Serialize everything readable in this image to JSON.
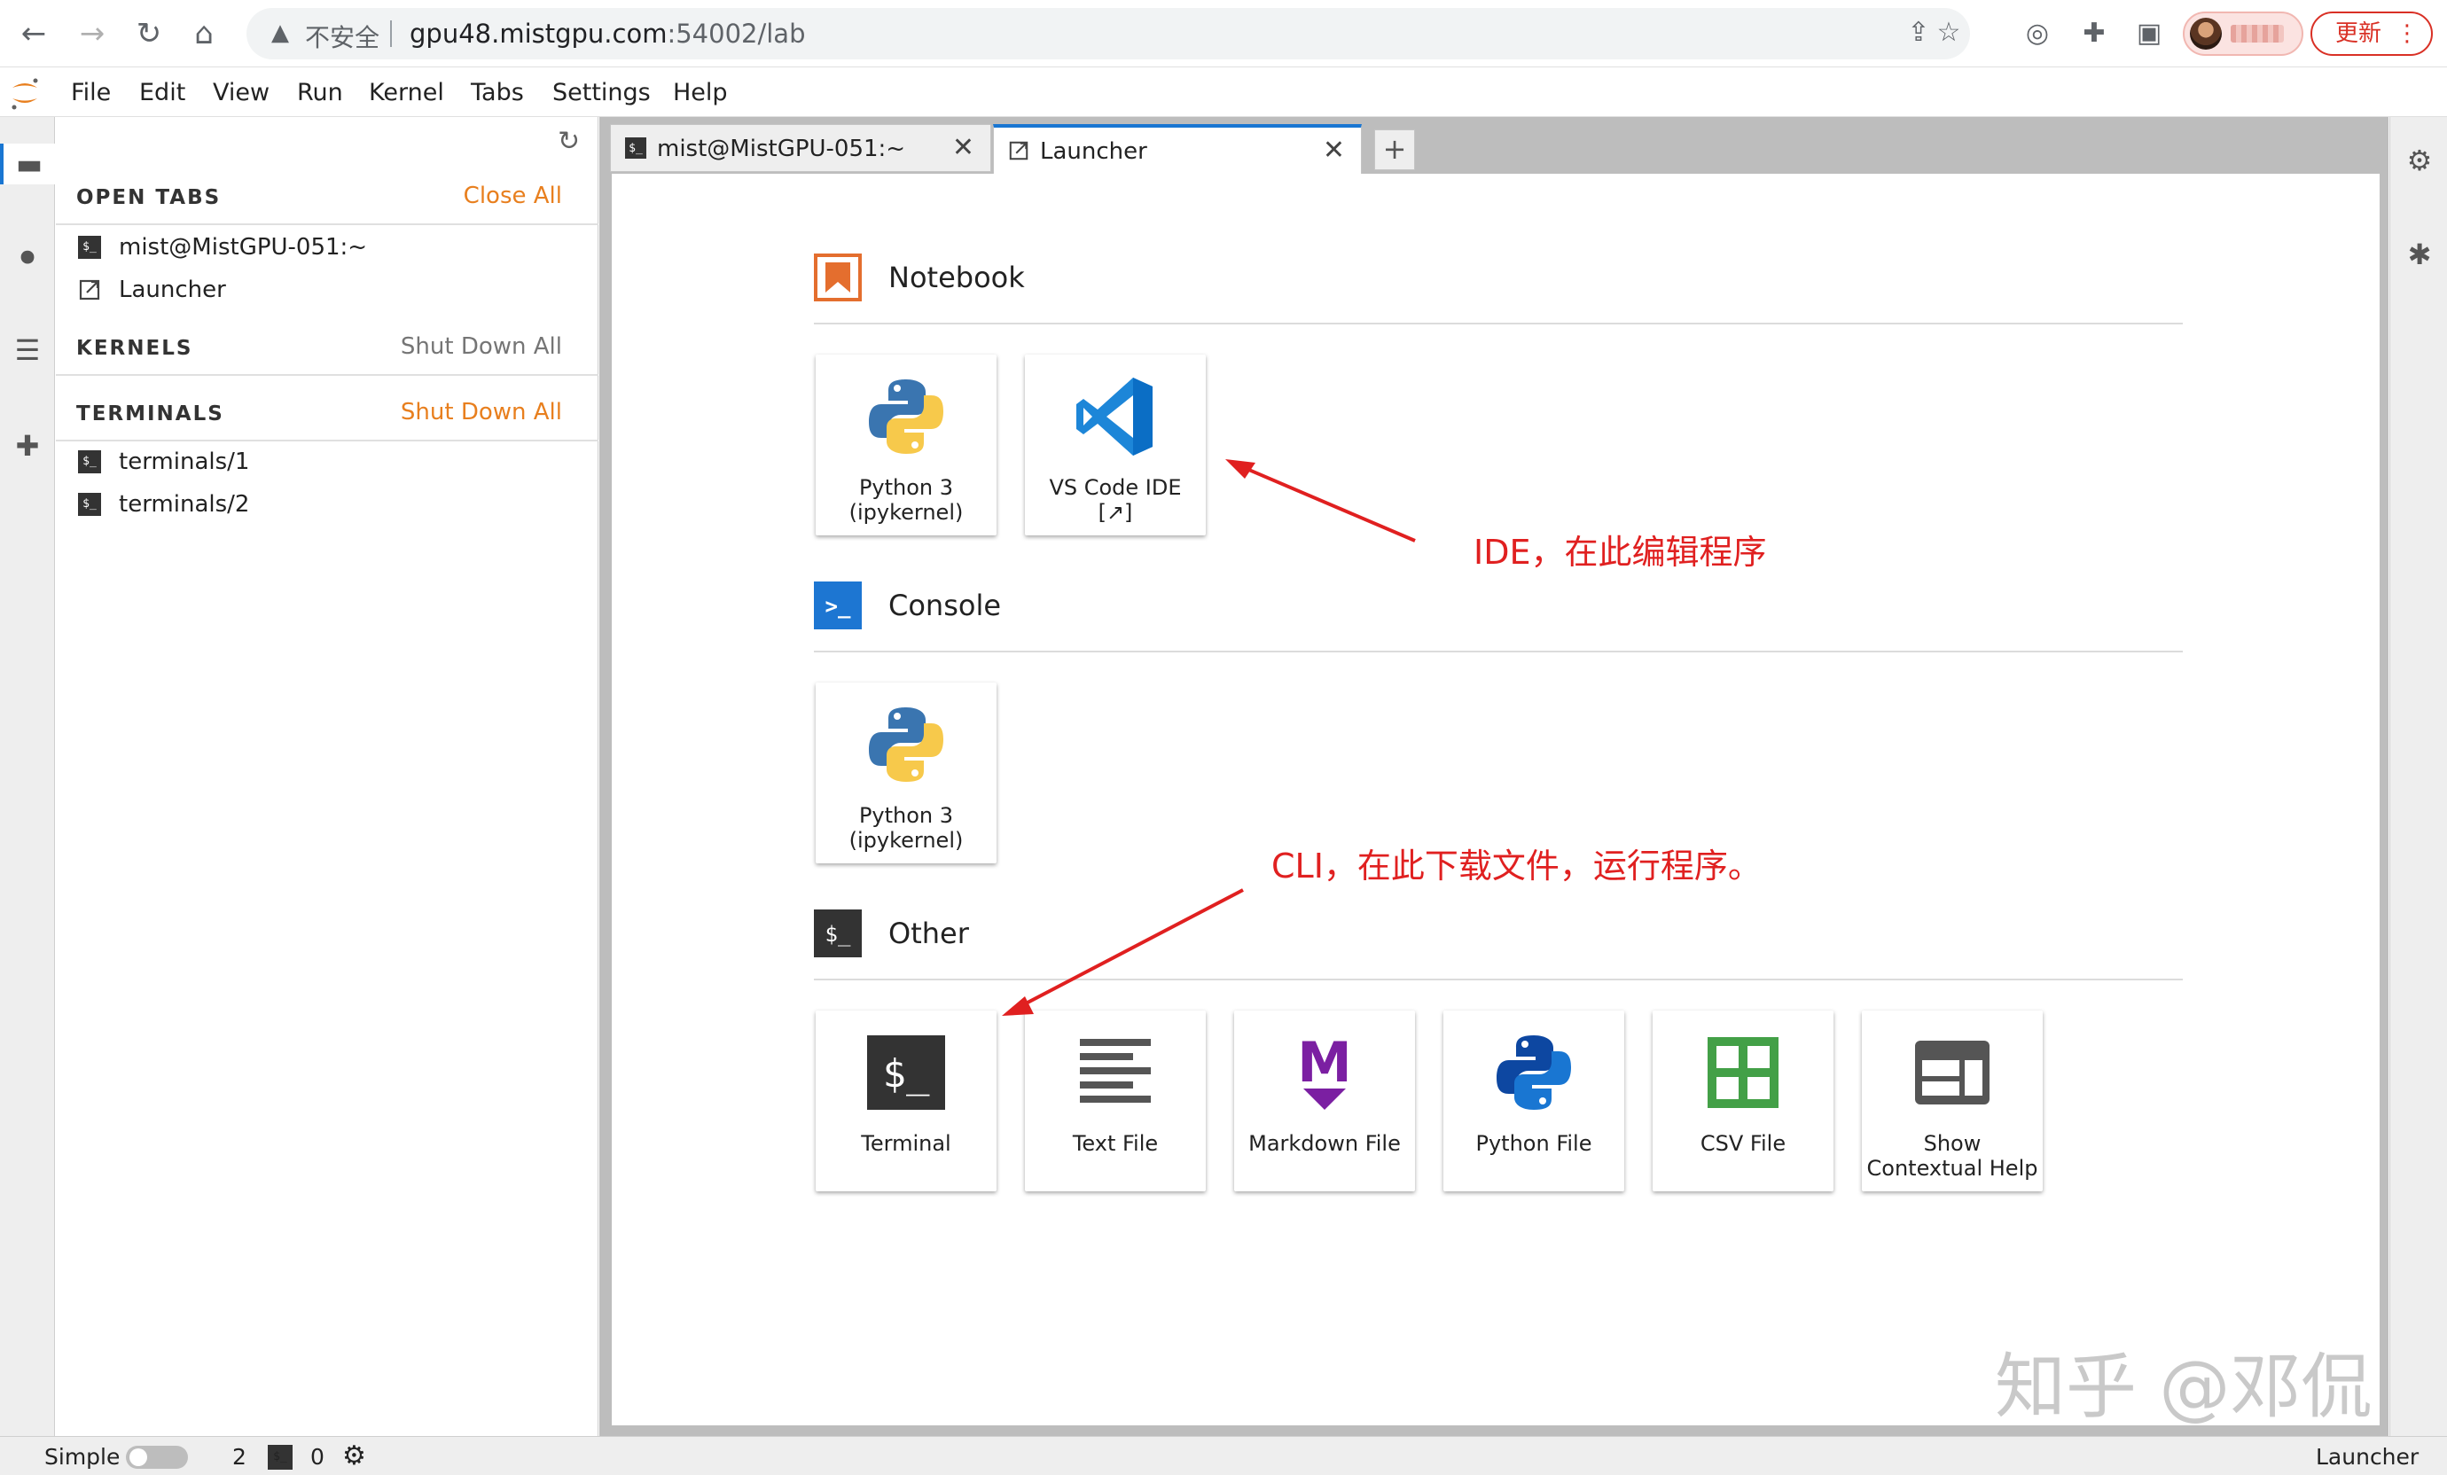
{
  "browser": {
    "insecure_label": "不安全",
    "url_host": "gpu48.mistgpu.com",
    "url_rest": ":54002/lab",
    "update_label": "更新",
    "update_more": "⋮"
  },
  "menu": [
    "File",
    "Edit",
    "View",
    "Run",
    "Kernel",
    "Tabs",
    "Settings",
    "Help"
  ],
  "sidebar": {
    "open_tabs": {
      "title": "OPEN TABS",
      "action": "Close All",
      "items": [
        "mist@MistGPU-051:~",
        "Launcher"
      ]
    },
    "kernels": {
      "title": "KERNELS",
      "action": "Shut Down All"
    },
    "terminals": {
      "title": "TERMINALS",
      "action": "Shut Down All",
      "items": [
        "terminals/1",
        "terminals/2"
      ]
    },
    "terminal_badge": "$_"
  },
  "tabs": [
    {
      "label": "mist@MistGPU-051:~",
      "close": "✕"
    },
    {
      "label": "Launcher",
      "close": "✕"
    }
  ],
  "new_tab": "+",
  "launcher": {
    "sections": [
      {
        "title": "Notebook",
        "cards": [
          {
            "label": "Python 3\n(ipykernel)"
          },
          {
            "label": "VS Code IDE\n[↗]"
          }
        ]
      },
      {
        "title": "Console",
        "cards": [
          {
            "label": "Python 3\n(ipykernel)"
          }
        ]
      },
      {
        "title": "Other",
        "cards": [
          {
            "label": "Terminal"
          },
          {
            "label": "Text File"
          },
          {
            "label": "Markdown File"
          },
          {
            "label": "Python File"
          },
          {
            "label": "CSV File"
          },
          {
            "label": "Show\nContextual Help"
          }
        ]
      }
    ],
    "console_icon_text": ">_",
    "other_icon_text": "$_",
    "terminal_icon_text": "$_",
    "markdown_icon_text": "M"
  },
  "annotations": {
    "ide": "IDE，在此编辑程序",
    "cli": "CLI，在此下载文件，运行程序。"
  },
  "watermark": "知乎 @邓侃",
  "status": {
    "mode": "Simple",
    "terminals_count": "2",
    "kernels_count": "0",
    "right": "Launcher"
  },
  "colors": {
    "accent": "#1976d2",
    "orange": "#e87f1e",
    "annotation": "#e02020"
  }
}
